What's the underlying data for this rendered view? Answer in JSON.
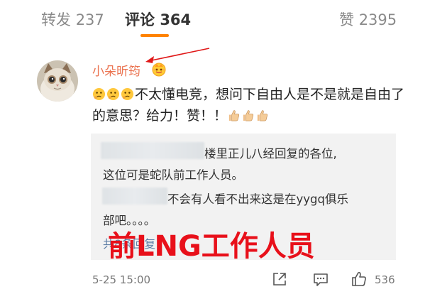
{
  "tabs": {
    "repost": {
      "label": "转发",
      "count": "237"
    },
    "comment": {
      "label": "评论",
      "count": "364"
    },
    "like": {
      "label": "赞",
      "count": "2395"
    },
    "active": "comment",
    "accent_color": "#ff8200"
  },
  "comment": {
    "avatar_icon": "cat-avatar",
    "username": "小朵昕筠",
    "username_color": "#eb7350",
    "user_badge_icon": "fan-badge-icon",
    "leading_emojis": [
      "thinking-emoji",
      "thinking-emoji",
      "thinking-emoji"
    ],
    "text": "不太懂电竞，想问下自由人是不是就是自由了的意思？给力！赞！！",
    "trailing_emojis": [
      "thumbs-up-emoji",
      "thumbs-up-emoji",
      "thumbs-up-emoji"
    ],
    "timestamp": "5-25 15:00",
    "like_count": "536"
  },
  "quoted_replies": {
    "line1": "楼里正儿八经回复的各位,",
    "line2": "这位可是蛇队前工作人员。",
    "line3": "不会有人看不出来这是在yygq俱乐",
    "line4": "部吧。。。。",
    "more_link": "共8条回复"
  },
  "overlay": {
    "caption": "前LNG工作人员",
    "caption_color": "#e8101a"
  },
  "actions": {
    "share_icon": "share-icon",
    "reply_icon": "comment-icon",
    "like_icon": "thumbs-up-icon"
  }
}
